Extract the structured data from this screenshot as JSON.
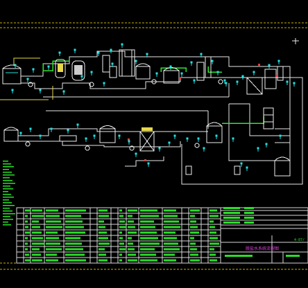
{
  "viewport": {
    "background": "#000000"
  },
  "colors": {
    "pipe_white": "#e8e8e8",
    "pipe_green": "#2ee82e",
    "pipe_yellow": "#e6d84a",
    "instrument_cyan": "#22e0e0",
    "equipment_white": "#f0f0f0",
    "frame_yellow": "#c8b400",
    "table_green": "#28e028",
    "table_line": "#d8d8d8",
    "accent_red": "#e83a3a",
    "title_magenta": "#e040e0"
  },
  "drawing": {
    "title_block_visible_text": {
      "drawing_number": "4-87/",
      "title": "脱盐水系统流程图"
    }
  },
  "icons": {
    "tank": "storage-tank-icon",
    "pump": "centrifugal-pump-icon",
    "valve": "gate-valve-icon",
    "instrument": "instrument-bubble-icon",
    "exchanger": "ion-exchanger-icon"
  }
}
